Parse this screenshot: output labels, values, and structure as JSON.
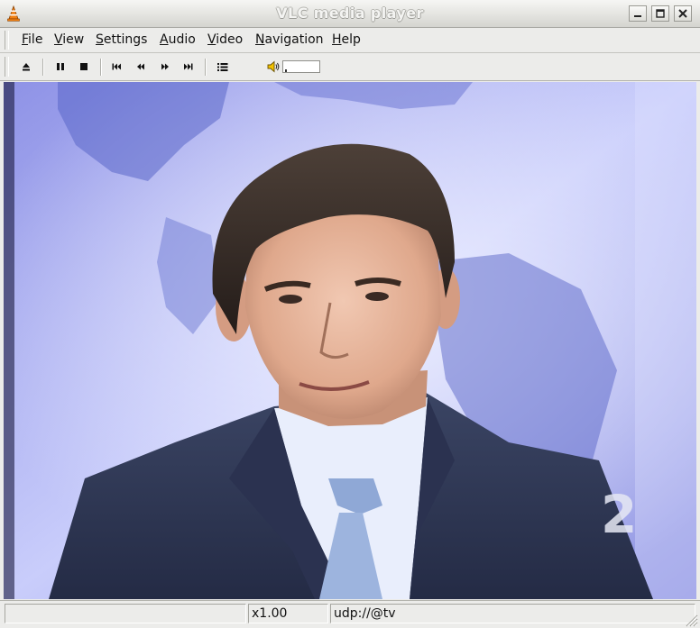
{
  "window": {
    "title": "VLC media player"
  },
  "menubar": {
    "items": [
      {
        "label": "File",
        "mnemonic": "F",
        "rest": "ile"
      },
      {
        "label": "View",
        "mnemonic": "V",
        "rest": "iew"
      },
      {
        "label": "Settings",
        "mnemonic": "S",
        "rest": "ettings"
      },
      {
        "label": "Audio",
        "mnemonic": "A",
        "rest": "udio"
      },
      {
        "label": "Video",
        "mnemonic": "V",
        "rest": "ideo"
      },
      {
        "label": "Navigation",
        "mnemonic": "N",
        "rest": "avigation"
      },
      {
        "label": "Help",
        "mnemonic": "H",
        "rest": "elp"
      }
    ]
  },
  "toolbar": {
    "buttons": [
      "eject-icon",
      "pause-icon",
      "stop-icon",
      "skip-previous-icon",
      "rewind-icon",
      "fast-forward-icon",
      "skip-next-icon",
      "playlist-icon"
    ],
    "volume_icon": "speaker-icon",
    "volume_level": 0.02
  },
  "video": {
    "content": "news-anchor-broadcast",
    "channel_logo_text": "2"
  },
  "statusbar": {
    "message": "",
    "speed": "x1.00",
    "stream": "udp://@tv"
  },
  "colors": {
    "chrome": "#ececea",
    "title_text": "#f4f4f2",
    "vlc_orange": "#f07f12"
  }
}
